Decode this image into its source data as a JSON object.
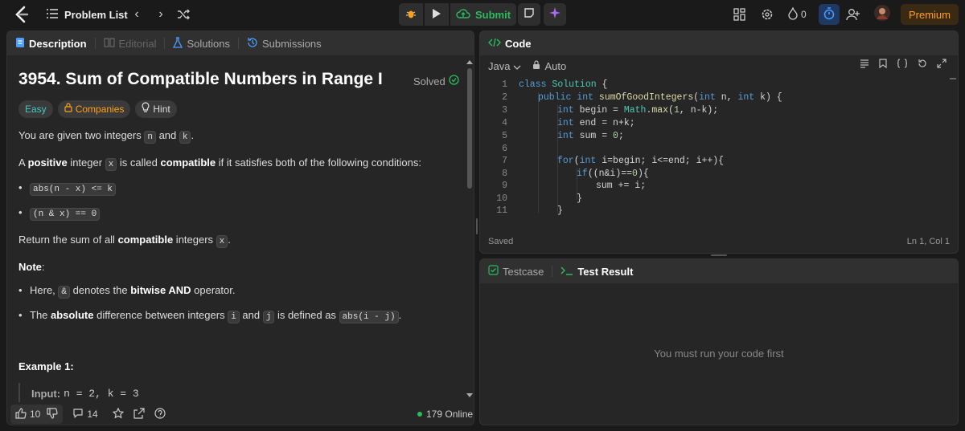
{
  "topbar": {
    "problem_list": "Problem List",
    "submit_label": "Submit",
    "streak_count": "0",
    "premium_label": "Premium"
  },
  "left_tabs": [
    {
      "label": "Description"
    },
    {
      "label": "Editorial"
    },
    {
      "label": "Solutions"
    },
    {
      "label": "Submissions"
    }
  ],
  "problem": {
    "title": "3954. Sum of Compatible Numbers in Range I",
    "status": "Solved",
    "tags": {
      "difficulty": "Easy",
      "companies": "Companies",
      "hint": "Hint"
    },
    "p1_a": "You are given two integers ",
    "var_n": "n",
    "p1_b": " and ",
    "var_k": "k",
    "p1_c": ".",
    "p2_a": "A ",
    "p2_positive": "positive",
    "p2_b": " integer ",
    "var_x": "x",
    "p2_c": " is called ",
    "p2_compatible": "compatible",
    "p2_d": " if it satisfies both of the following conditions:",
    "cond1": "abs(n - x) <= k",
    "cond2": "(n & x) == 0",
    "p3_a": "Return the sum of all ",
    "p3_compatible": "compatible",
    "p3_b": " integers ",
    "p3_c": ".",
    "note_label": "Note",
    "note_colon": ":",
    "n1_a": "Here, ",
    "amp": "&",
    "n1_b": " denotes the ",
    "n1_bold": "bitwise AND",
    "n1_c": " operator.",
    "n2_a": "The ",
    "n2_bold": "absolute",
    "n2_b": " difference between integers ",
    "var_i": "i",
    "n2_c": " and ",
    "var_j": "j",
    "n2_d": " is defined as ",
    "abs_ij": "abs(i - j)",
    "n2_e": ".",
    "example_title": "Example 1:",
    "example_input_label": "Input:",
    "example_input_value": "n = 2, k = 3"
  },
  "left_footer": {
    "likes": "10",
    "comments": "14",
    "online": "179 Online"
  },
  "code_panel": {
    "title": "Code",
    "language": "Java",
    "mode": "Auto",
    "saved": "Saved",
    "cursor": "Ln 1, Col 1",
    "lines": [
      {
        "n": "1",
        "indent": 0
      },
      {
        "n": "2",
        "indent": 1
      },
      {
        "n": "3",
        "indent": 2
      },
      {
        "n": "4",
        "indent": 2
      },
      {
        "n": "5",
        "indent": 2
      },
      {
        "n": "6",
        "indent": 0
      },
      {
        "n": "7",
        "indent": 2
      },
      {
        "n": "8",
        "indent": 3
      },
      {
        "n": "9",
        "indent": 4
      },
      {
        "n": "10",
        "indent": 3
      },
      {
        "n": "11",
        "indent": 2
      }
    ],
    "code": {
      "l1_kw": "class",
      "l1_ty": "Solution",
      "l1_rest": " {",
      "l2_kw": "public int",
      "l2_fn": "sumOfGoodIntegers",
      "l2_a": "(",
      "l2_t1": "int",
      "l2_b": " n, ",
      "l2_t2": "int",
      "l2_c": " k) {",
      "l3_t": "int",
      "l3_a": " begin = ",
      "l3_ty": "Math",
      "l3_b": ".",
      "l3_fn": "max",
      "l3_c": "(",
      "l3_n": "1",
      "l3_d": ", n-k);",
      "l4_t": "int",
      "l4_a": " end = n+k;",
      "l5_t": "int",
      "l5_a": " sum = ",
      "l5_n": "0",
      "l5_b": ";",
      "l7_kw": "for",
      "l7_a": "(",
      "l7_t": "int",
      "l7_b": " i=begin; i<=end; i++){",
      "l8_kw": "if",
      "l8_a": "((n&i)==",
      "l8_n": "0",
      "l8_b": "){",
      "l9": "sum += i;",
      "l10": "}",
      "l11": "}"
    }
  },
  "test_panel": {
    "tab1": "Testcase",
    "tab2": "Test Result",
    "empty": "You must run your code first"
  }
}
